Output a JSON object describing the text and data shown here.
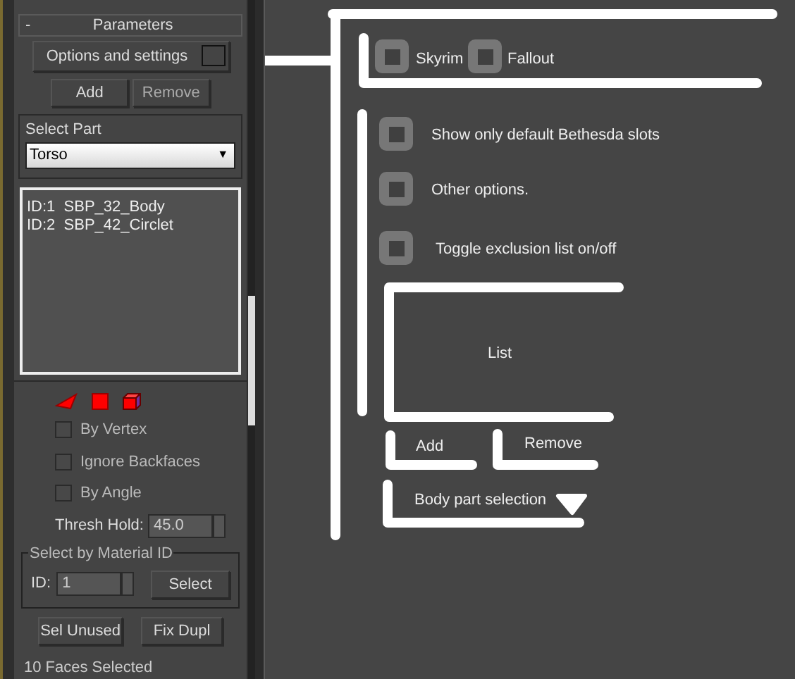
{
  "panel": {
    "collapse_symbol": "-",
    "rollout_title": "Parameters",
    "options_button": "Options and settings",
    "buttons": [
      "Add",
      "Remove"
    ],
    "select_part": {
      "label": "Select Part",
      "value": "Torso",
      "arrow": "▼"
    },
    "parts_list": [
      "ID:1  SBP_32_Body",
      "ID:2  SBP_42_Circlet"
    ],
    "selection_options": [
      {
        "label": "By Vertex",
        "checked": false
      },
      {
        "label": "Ignore Backfaces",
        "checked": false
      },
      {
        "label": "By Angle",
        "checked": false
      }
    ],
    "thresh": {
      "label": "Thresh Hold:",
      "value": "45.0"
    },
    "material_group": {
      "title": "Select by Material ID",
      "id_label": "ID:",
      "id_value": "1",
      "button": "Select"
    },
    "bottom_buttons": [
      "Sel Unused",
      "Fix Dupl"
    ],
    "status": "10 Faces Selected"
  },
  "mockup": {
    "games": [
      {
        "label": "Skyrim",
        "checked": false
      },
      {
        "label": "Fallout",
        "checked": false
      }
    ],
    "options": [
      {
        "label": "Show only default Bethesda slots",
        "checked": false
      },
      {
        "label": "Other options.",
        "checked": false
      },
      {
        "label": "Toggle exclusion list on/off",
        "checked": false
      }
    ],
    "list_label": "List",
    "buttons": [
      "Add",
      "Remove"
    ],
    "dropdown_label": "Body part selection"
  }
}
